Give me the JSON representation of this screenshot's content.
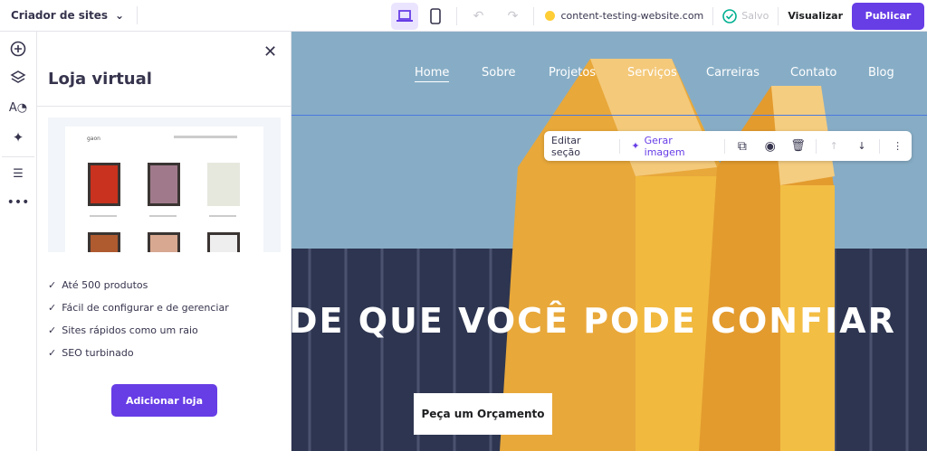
{
  "topbar": {
    "brand": "Criador de sites",
    "domain": "content-testing-website.com",
    "saved": "Salvo",
    "preview": "Visualizar",
    "publish": "Publicar"
  },
  "panel": {
    "title": "Loja virtual",
    "features": [
      "Até 500 produtos",
      "Fácil de configurar e de gerenciar",
      "Sites rápidos como um raio",
      "SEO turbinado"
    ],
    "add_button": "Adicionar loja"
  },
  "site": {
    "nav": [
      "Home",
      "Sobre",
      "Projetos",
      "Serviços",
      "Carreiras",
      "Contato",
      "Blog"
    ],
    "headline": "DE QUE VOCÊ PODE CONFIAR",
    "cta": "Peça um Orçamento"
  },
  "section_toolbar": {
    "edit": "Editar seção",
    "generate": "Gerar imagem"
  },
  "colors": {
    "accent": "#673de6",
    "saved_check": "#00b090",
    "domain_dot": "#ffcd35"
  }
}
